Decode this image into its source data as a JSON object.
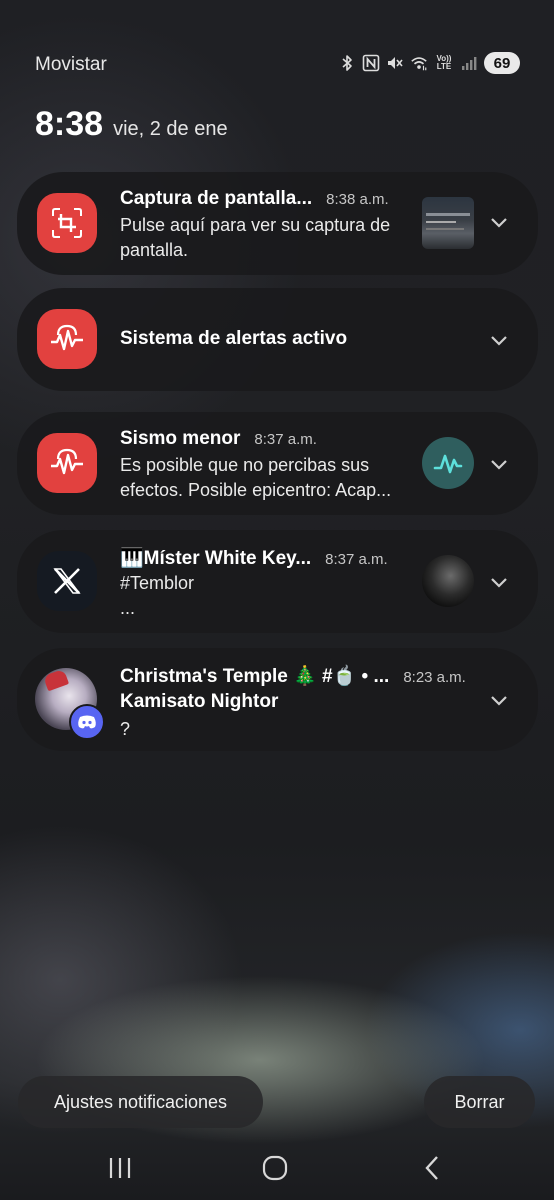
{
  "status_bar": {
    "carrier": "Movistar",
    "icons": [
      "bluetooth-icon",
      "nfc-icon",
      "mute-icon",
      "wifi-icon",
      "volte-icon",
      "signal-icon"
    ],
    "volte_top": "Vo))",
    "volte_bottom": "LTE",
    "battery": "69"
  },
  "clock": {
    "time": "8:38",
    "date": "vie, 2 de ene"
  },
  "notifications": [
    {
      "app_icon": "screenshot-icon",
      "title": "Captura de pantalla...",
      "time": "8:38 a.m.",
      "body": "Pulse aquí para ver su captura de pantalla.",
      "thumbnail": "screenshot-thumbnail"
    },
    {
      "app_icon": "alert-pulse-icon",
      "title": "Sistema de alertas activo"
    },
    {
      "app_icon": "alert-pulse-icon",
      "title": "Sismo menor",
      "time": "8:37 a.m.",
      "body": "Es posible que no percibas sus efectos. Posible epicentro: Acap...",
      "thumbnail": "seismic-wave-icon"
    },
    {
      "app_icon": "x-logo-icon",
      "title": "🎹Míster White Key...",
      "time": "8:37 a.m.",
      "body_line1": "#Temblor",
      "body_line2": "...",
      "thumbnail": "profile-photo"
    },
    {
      "app_icon": "avatar-discord",
      "title": "Christma's Temple 🎄 #🍵 • ...",
      "time": "8:23 a.m.",
      "subtitle": "Kamisato Nightor",
      "body": "?"
    }
  ],
  "actions": {
    "settings_label": "Ajustes notificaciones",
    "clear_label": "Borrar"
  },
  "navbar": {
    "icons": [
      "recents-icon",
      "home-icon",
      "back-icon"
    ]
  },
  "colors": {
    "alert_red": "#e2413f",
    "card_bg": "#1a1a1c",
    "teal": "#3fc8c4",
    "discord": "#5865f2"
  }
}
